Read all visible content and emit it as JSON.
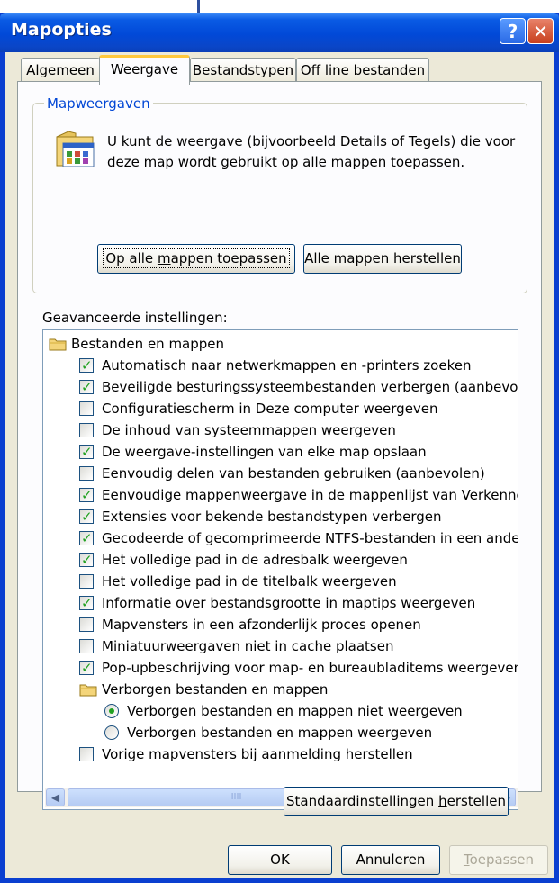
{
  "window": {
    "title": "Mapopties",
    "help_icon": "?",
    "close_icon": "✕"
  },
  "tabs": [
    {
      "label": "Algemeen"
    },
    {
      "label": "Weergave"
    },
    {
      "label": "Bestandstypen"
    },
    {
      "label": "Off line bestanden"
    }
  ],
  "folder_views": {
    "legend": "Mapweergaven",
    "description_line1": "U kunt de weergave (bijvoorbeeld Details of Tegels) die voor",
    "description_line2": "deze map wordt gebruikt op alle mappen toepassen.",
    "apply_all_pre": "Op alle ",
    "apply_all_accel": "m",
    "apply_all_post": "appen toepassen",
    "reset_all": "Alle mappen herstellen"
  },
  "advanced": {
    "label": "Geavanceerde instellingen:",
    "folder_files": "Bestanden en mappen",
    "items": [
      {
        "label": "Automatisch naar netwerkmappen en -printers zoeken",
        "checked": true
      },
      {
        "label": "Beveiligde besturingssysteembestanden verbergen (aanbevole",
        "checked": true
      },
      {
        "label": "Configuratiescherm in Deze computer weergeven",
        "checked": false
      },
      {
        "label": "De inhoud van systeemmappen weergeven",
        "checked": false
      },
      {
        "label": "De weergave-instellingen van elke map opslaan",
        "checked": true
      },
      {
        "label": "Eenvoudig delen van bestanden gebruiken (aanbevolen)",
        "checked": false
      },
      {
        "label": "Eenvoudige mappenweergave in de mappenlijst van Verkenne",
        "checked": true
      },
      {
        "label": "Extensies voor bekende bestandstypen verbergen",
        "checked": true
      },
      {
        "label": "Gecodeerde of gecomprimeerde NTFS-bestanden in een ande",
        "checked": true
      },
      {
        "label": "Het volledige pad in de adresbalk weergeven",
        "checked": true
      },
      {
        "label": "Het volledige pad in de titelbalk weergeven",
        "checked": false
      },
      {
        "label": "Informatie over bestandsgrootte in maptips weergeven",
        "checked": true
      },
      {
        "label": "Mapvensters in een afzonderlijk proces openen",
        "checked": false
      },
      {
        "label": "Miniatuurweergaven niet in cache plaatsen",
        "checked": false
      },
      {
        "label": "Pop-upbeschrijving voor map- en bureaubladitems weergeven",
        "checked": true
      }
    ],
    "hidden_folder": "Verborgen bestanden en mappen",
    "hidden_options": [
      {
        "label": "Verborgen bestanden en mappen niet weergeven",
        "selected": true
      },
      {
        "label": "Verborgen bestanden en mappen weergeven",
        "selected": false
      }
    ],
    "restore_item": {
      "label": "Vorige mapvensters bij aanmelding herstellen",
      "checked": false
    },
    "scroll_left": "◀",
    "scroll_right": "▶",
    "scroll_grip": "IIII"
  },
  "restore_defaults_pre": "Standaardinstellingen ",
  "restore_defaults_accel": "h",
  "restore_defaults_post": "erstellen",
  "dialog_buttons": {
    "ok": "OK",
    "cancel": "Annuleren",
    "apply_accel": "T",
    "apply_post": "oepassen"
  }
}
